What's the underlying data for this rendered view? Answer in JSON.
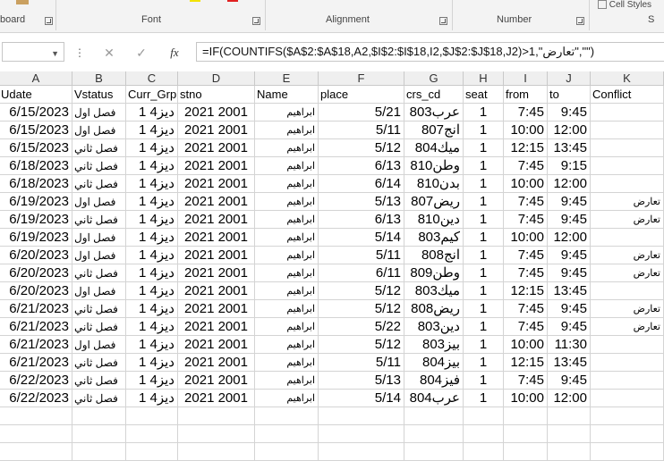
{
  "ribbon": {
    "groups": [
      "board",
      "Font",
      "Alignment",
      "Number"
    ],
    "partial_right": "S",
    "cell_styles": "Cell Styles"
  },
  "formula_bar": {
    "name_box": "",
    "cancel_icon": "✕",
    "enter_icon": "✓",
    "fx_icon": "fx",
    "formula": "=IF(COUNTIFS($A$2:$A$18,A2,$I$2:$I$18,I2,$J$2:$J$18,J2)>1,\"تعارض\",\"\")"
  },
  "columns": [
    "A",
    "B",
    "C",
    "D",
    "E",
    "F",
    "G",
    "H",
    "I",
    "J",
    "K"
  ],
  "headers": [
    "Udate",
    "Vstatus",
    "Curr_Grp",
    "stno",
    "Name",
    "place",
    "crs_cd",
    "seat",
    "from",
    "to",
    "Conflict"
  ],
  "rows": [
    [
      "6/15/2023",
      "فصل اول",
      "ديز4 1",
      "2021 2001",
      "ابراهيم",
      "5/21",
      "عرب803",
      "1",
      "7:45",
      "9:45",
      ""
    ],
    [
      "6/15/2023",
      "فصل اول",
      "ديز4 1",
      "2021 2001",
      "ابراهيم",
      "5/11",
      "انج807",
      "1",
      "10:00",
      "12:00",
      ""
    ],
    [
      "6/15/2023",
      "فصل ثاني",
      "ديز4 1",
      "2021 2001",
      "ابراهيم",
      "5/12",
      "ميك804",
      "1",
      "12:15",
      "13:45",
      ""
    ],
    [
      "6/18/2023",
      "فصل ثاني",
      "ديز4 1",
      "2021 2001",
      "ابراهيم",
      "6/13",
      "وطن810",
      "1",
      "7:45",
      "9:15",
      ""
    ],
    [
      "6/18/2023",
      "فصل ثاني",
      "ديز4 1",
      "2021 2001",
      "ابراهيم",
      "6/14",
      "بدن810",
      "1",
      "10:00",
      "12:00",
      ""
    ],
    [
      "6/19/2023",
      "فصل اول",
      "ديز4 1",
      "2021 2001",
      "ابراهيم",
      "5/13",
      "ريض807",
      "1",
      "7:45",
      "9:45",
      "تعارض"
    ],
    [
      "6/19/2023",
      "فصل ثاني",
      "ديز4 1",
      "2021 2001",
      "ابراهيم",
      "6/13",
      "دين810",
      "1",
      "7:45",
      "9:45",
      "تعارض"
    ],
    [
      "6/19/2023",
      "فصل اول",
      "ديز4 1",
      "2021 2001",
      "ابراهيم",
      "5/14",
      "كيم803",
      "1",
      "10:00",
      "12:00",
      ""
    ],
    [
      "6/20/2023",
      "فصل اول",
      "ديز4 1",
      "2021 2001",
      "ابراهيم",
      "5/11",
      "انج808",
      "1",
      "7:45",
      "9:45",
      "تعارض"
    ],
    [
      "6/20/2023",
      "فصل ثاني",
      "ديز4 1",
      "2021 2001",
      "ابراهيم",
      "6/11",
      "وطن809",
      "1",
      "7:45",
      "9:45",
      "تعارض"
    ],
    [
      "6/20/2023",
      "فصل اول",
      "ديز4 1",
      "2021 2001",
      "ابراهيم",
      "5/12",
      "ميك803",
      "1",
      "12:15",
      "13:45",
      ""
    ],
    [
      "6/21/2023",
      "فصل ثاني",
      "ديز4 1",
      "2021 2001",
      "ابراهيم",
      "5/12",
      "ريض808",
      "1",
      "7:45",
      "9:45",
      "تعارض"
    ],
    [
      "6/21/2023",
      "فصل ثاني",
      "ديز4 1",
      "2021 2001",
      "ابراهيم",
      "5/22",
      "دين803",
      "1",
      "7:45",
      "9:45",
      "تعارض"
    ],
    [
      "6/21/2023",
      "فصل اول",
      "ديز4 1",
      "2021 2001",
      "ابراهيم",
      "5/12",
      "بيز803",
      "1",
      "10:00",
      "11:30",
      ""
    ],
    [
      "6/21/2023",
      "فصل ثاني",
      "ديز4 1",
      "2021 2001",
      "ابراهيم",
      "5/11",
      "بيز804",
      "1",
      "12:15",
      "13:45",
      ""
    ],
    [
      "6/22/2023",
      "فصل ثاني",
      "ديز4 1",
      "2021 2001",
      "ابراهيم",
      "5/13",
      "فيز804",
      "1",
      "7:45",
      "9:45",
      ""
    ],
    [
      "6/22/2023",
      "فصل ثاني",
      "ديز4 1",
      "2021 2001",
      "ابراهيم",
      "5/14",
      "عرب804",
      "1",
      "10:00",
      "12:00",
      ""
    ]
  ]
}
